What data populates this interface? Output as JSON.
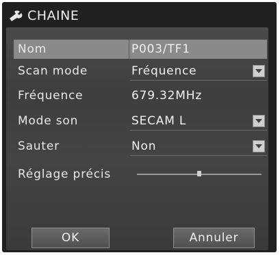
{
  "title": "CHAINE",
  "title_icon": "wrench-icon",
  "rows": [
    {
      "label": "Nom",
      "value": "P003/TF1"
    },
    {
      "label": "Scan mode",
      "value": "Fréquence"
    },
    {
      "label": "Fréquence",
      "value": "679.32MHz"
    },
    {
      "label": "Mode son",
      "value": "SECAM L"
    },
    {
      "label": "Sauter",
      "value": "Non"
    },
    {
      "label": "Réglage précis"
    }
  ],
  "fine_tune_level": 0.5,
  "buttons": {
    "ok": "OK",
    "cancel": "Annuler"
  }
}
